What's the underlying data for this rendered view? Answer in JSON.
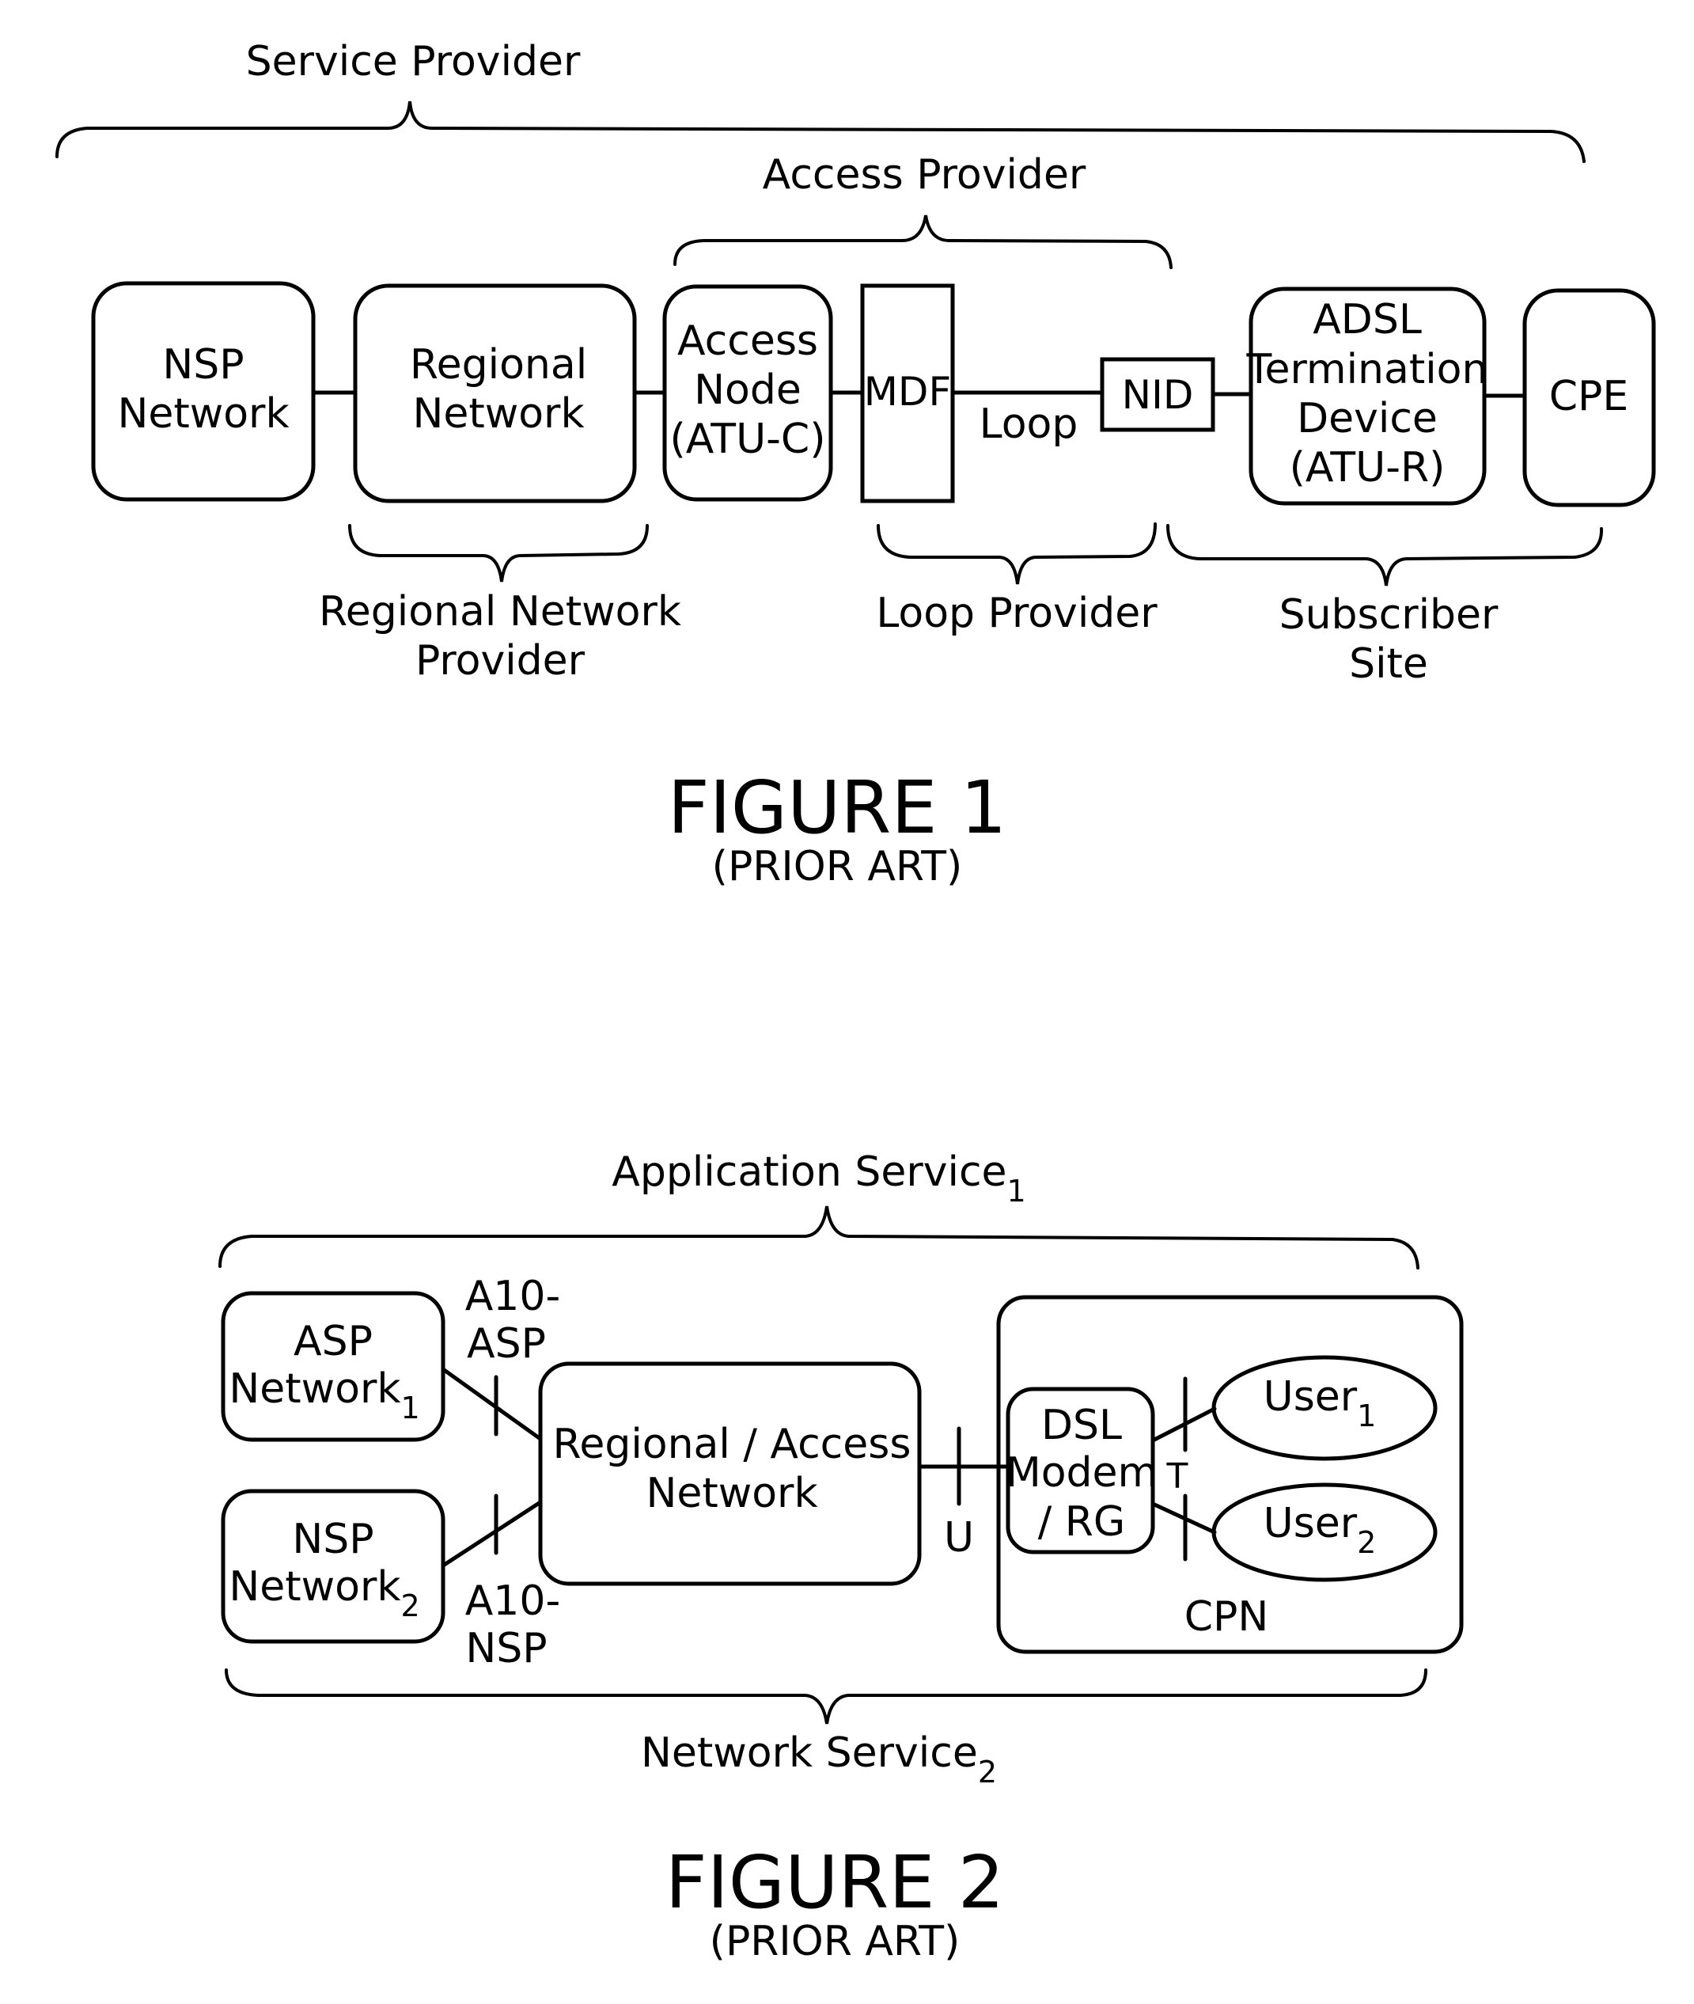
{
  "figure1": {
    "title": "FIGURE 1",
    "subtitle": "(PRIOR ART)",
    "brackets": {
      "service_provider": "Service Provider",
      "access_provider": "Access Provider",
      "regional_network_provider": [
        "Regional Network",
        "Provider"
      ],
      "loop_provider": "Loop Provider",
      "subscriber_site": [
        "Subscriber",
        "Site"
      ]
    },
    "nodes": {
      "nsp": [
        "NSP",
        "Network"
      ],
      "regional": [
        "Regional",
        "Network"
      ],
      "access_node": [
        "Access",
        "Node",
        "(ATU-C)"
      ],
      "mdf": "MDF",
      "nid": "NID",
      "adsl": [
        "ADSL",
        "Termination",
        "Device",
        "(ATU-R)"
      ],
      "cpe": "CPE"
    },
    "loop_label": "Loop"
  },
  "figure2": {
    "title": "FIGURE 2",
    "subtitle": "(PRIOR ART)",
    "brackets": {
      "application_service": {
        "text": "Application Service",
        "sub": "1"
      },
      "network_service": {
        "text": "Network Service",
        "sub": "2"
      }
    },
    "nodes": {
      "asp": {
        "line1": "ASP",
        "line2": "Network",
        "sub": "1"
      },
      "nsp": {
        "line1": "NSP",
        "line2": "Network",
        "sub": "2"
      },
      "regional_access": [
        "Regional / Access",
        "Network"
      ],
      "dsl_modem": [
        "DSL",
        "Modem",
        "/ RG"
      ],
      "user1": {
        "text": "User",
        "sub": "1"
      },
      "user2": {
        "text": "User",
        "sub": "2"
      },
      "cpn": "CPN"
    },
    "interfaces": {
      "a10_asp": [
        "A10-",
        "ASP"
      ],
      "a10_nsp": [
        "A10-",
        "NSP"
      ],
      "u": "U",
      "t": "T"
    }
  }
}
